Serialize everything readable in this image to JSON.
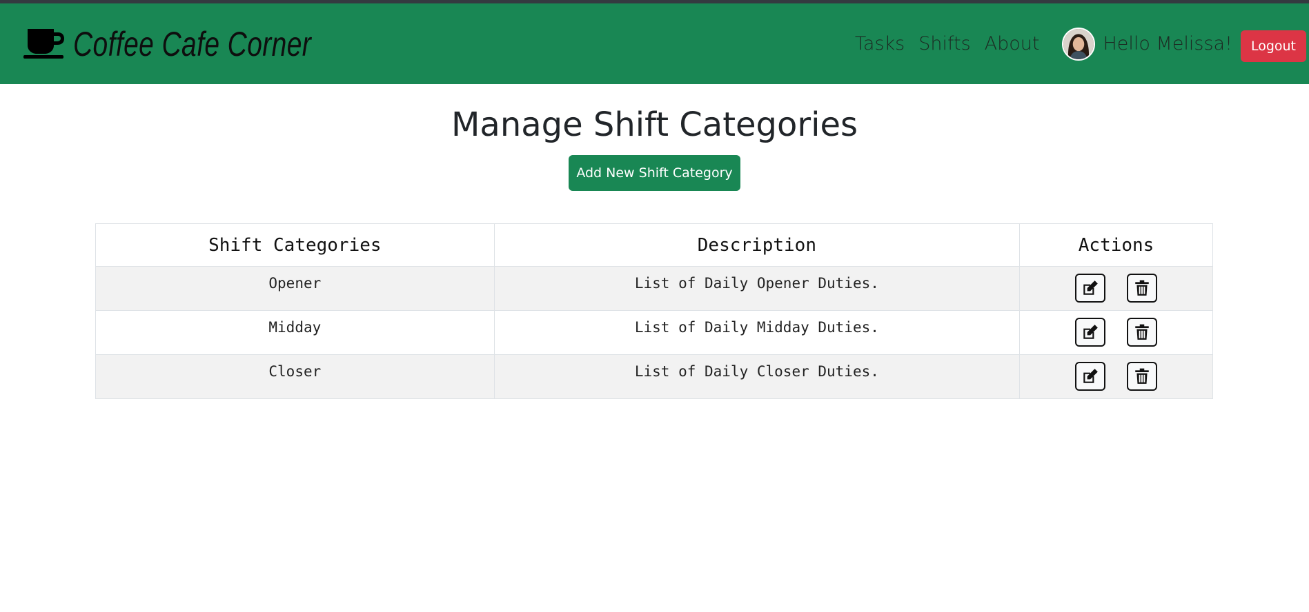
{
  "brand": {
    "title": "Coffee Cafe Corner",
    "icon": "coffee-cup-icon"
  },
  "nav": {
    "links": [
      "Tasks",
      "Shifts",
      "About"
    ],
    "greeting": "Hello Melissa!",
    "logout_label": "Logout"
  },
  "page": {
    "title": "Manage Shift Categories",
    "add_button_label": "Add New Shift Category"
  },
  "table": {
    "headers": [
      "Shift Categories",
      "Description",
      "Actions"
    ],
    "rows": [
      {
        "category": "Opener",
        "description": "List of Daily Opener Duties."
      },
      {
        "category": "Midday",
        "description": "List of Daily Midday Duties."
      },
      {
        "category": "Closer",
        "description": "List of Daily Closer Duties."
      }
    ]
  },
  "colors": {
    "navbar": "#198754",
    "logout": "#dc3545",
    "add_button": "#198754"
  }
}
